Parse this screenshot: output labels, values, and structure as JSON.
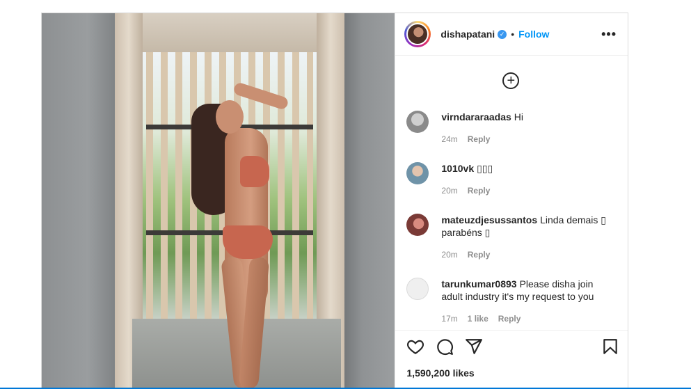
{
  "post": {
    "author": {
      "username": "dishapatani",
      "verified": true,
      "follow_label": "Follow",
      "separator": "•"
    },
    "more_icon": "more-horizontal-icon",
    "load_more_icon": "plus-circle-icon",
    "comments": [
      {
        "username": "virndararaadas",
        "text": "Hi",
        "time": "24m",
        "likes": "",
        "reply": "Reply",
        "avatar_color": "#9a9a9a"
      },
      {
        "username": "1010vk",
        "text": "▯▯▯",
        "time": "20m",
        "likes": "",
        "reply": "Reply",
        "avatar_color": "#6f93a8"
      },
      {
        "username": "mateuzdjesussantos",
        "text": "Linda demais ▯ parabéns ▯",
        "time": "20m",
        "likes": "",
        "reply": "Reply",
        "avatar_color": "#b05a55"
      },
      {
        "username": "tarunkumar0893",
        "text": "Please disha join adult industry it's my request to you",
        "time": "17m",
        "likes": "1 like",
        "reply": "Reply",
        "avatar_color": "#dbdbdb"
      }
    ],
    "actions": {
      "like_icon": "heart-icon",
      "comment_icon": "comment-icon",
      "share_icon": "send-icon",
      "save_icon": "bookmark-icon"
    },
    "likes_count": "1,590,200 likes",
    "colors": {
      "accent": "#0095f6",
      "verified": "#3897f0"
    }
  }
}
